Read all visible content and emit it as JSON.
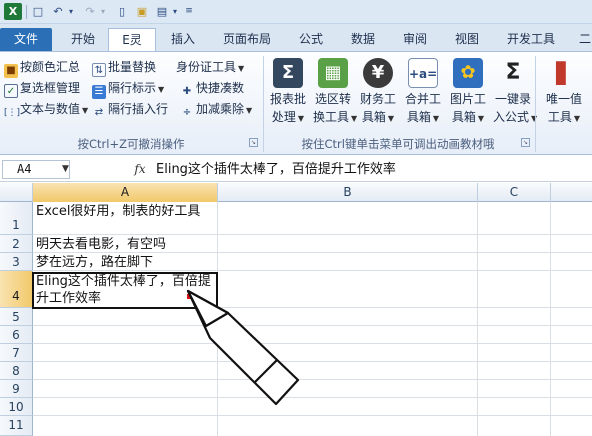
{
  "tabs": [
    {
      "label": "文件"
    },
    {
      "label": "开始"
    },
    {
      "label": "E灵"
    },
    {
      "label": "插入"
    },
    {
      "label": "页面布局"
    },
    {
      "label": "公式"
    },
    {
      "label": "数据"
    },
    {
      "label": "审阅"
    },
    {
      "label": "视图"
    },
    {
      "label": "开发工具"
    },
    {
      "label": "二"
    }
  ],
  "ribbon": {
    "group1": {
      "items": [
        {
          "label": "按颜色汇总"
        },
        {
          "label": "批量替换"
        },
        {
          "label": "身份证工具"
        },
        {
          "label": "复选框管理"
        },
        {
          "label": "隔行标示"
        },
        {
          "label": "快捷凑数"
        },
        {
          "label": "文本与数值"
        },
        {
          "label": "隔行插入行"
        },
        {
          "label": "加减乘除"
        }
      ],
      "title": "按Ctrl+Z可撤消操作"
    },
    "group2": {
      "buttons": [
        {
          "line1": "报表批",
          "line2": "处理"
        },
        {
          "line1": "选区转",
          "line2": "换工具"
        },
        {
          "line1": "财务工",
          "line2": "具箱"
        },
        {
          "line1": "合并工",
          "line2": "具箱"
        },
        {
          "line1": "图片工",
          "line2": "具箱"
        },
        {
          "line1": "一键录",
          "line2": "入公式"
        }
      ],
      "title": "按住Ctrl键单击菜单可调出动画教材哦"
    },
    "group3": {
      "buttons": [
        {
          "line1": "唯一值",
          "line2": "工具"
        }
      ]
    }
  },
  "formula_bar": {
    "name_box": "A4",
    "fx_label": "fx",
    "content": "Eling这个插件太棒了，百倍提升工作效率"
  },
  "grid": {
    "columns": [
      "A",
      "B",
      "C"
    ],
    "rows": [
      "1",
      "2",
      "3",
      "4",
      "5",
      "6",
      "7",
      "8",
      "9",
      "10",
      "11"
    ],
    "cells": {
      "A1": "Excel很好用，制表的好工具",
      "A2": "明天去看电影，有空吗",
      "A3": "梦在远方，路在脚下",
      "A4": "Eling这个插件太棒了，百倍提升工作效率"
    },
    "selected_cell": "A4"
  }
}
